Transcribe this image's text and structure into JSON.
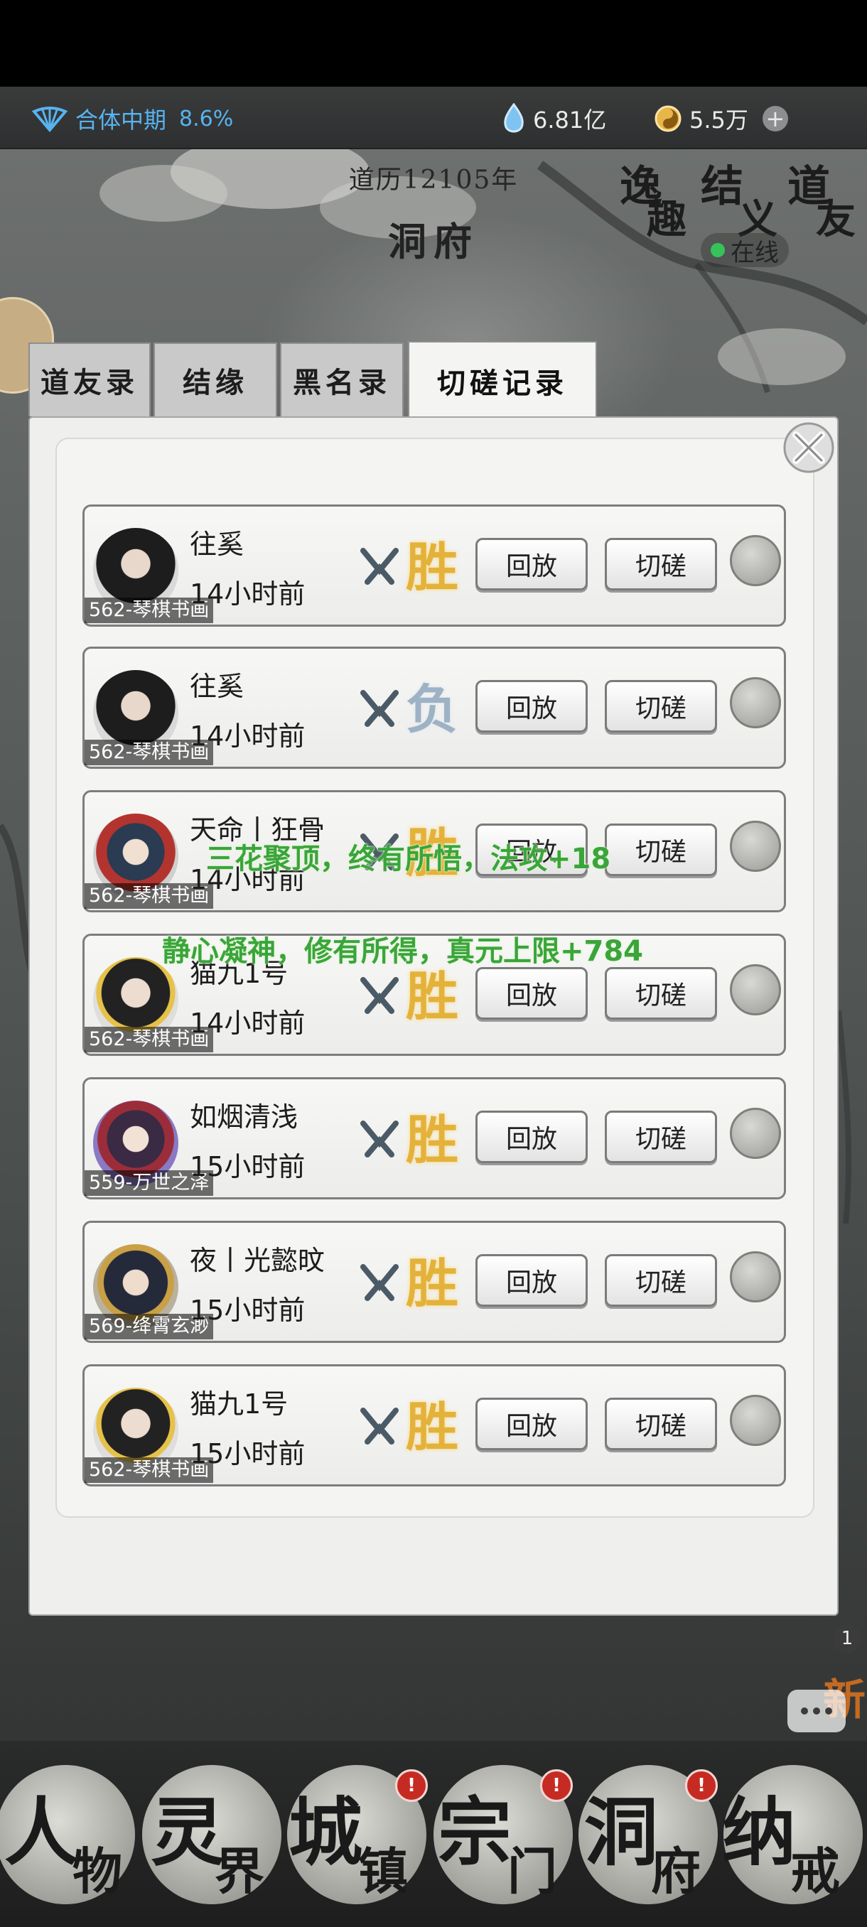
{
  "header": {
    "realm": {
      "icon": "fan-icon",
      "label": "合体中期",
      "percent": "8.6%"
    },
    "resources": [
      {
        "icon": "spirit-stone-icon",
        "value": "6.81亿"
      },
      {
        "icon": "coin-icon",
        "value": "5.5万"
      }
    ],
    "add_label": "+"
  },
  "calendar": "道历12105年",
  "page_title": "洞府",
  "seal": {
    "chars": [
      "逸",
      "趣",
      "结",
      "义",
      "道",
      "友"
    ]
  },
  "online_label": "在线",
  "tabs": [
    {
      "label": "道友录",
      "active": false
    },
    {
      "label": "结缘",
      "active": false
    },
    {
      "label": "黑名录",
      "active": false
    },
    {
      "label": "切磋记录",
      "active": true
    }
  ],
  "records": [
    {
      "name": "往奚",
      "time": "14小时前",
      "server": "562-琴棋书画",
      "result": "胜",
      "outcome": "win"
    },
    {
      "name": "往奚",
      "time": "14小时前",
      "server": "562-琴棋书画",
      "result": "负",
      "outcome": "lose"
    },
    {
      "name": "天命丨狂骨",
      "time": "14小时前",
      "server": "562-琴棋书画",
      "result": "胜",
      "outcome": "win"
    },
    {
      "name": "猫九1号",
      "time": "14小时前",
      "server": "562-琴棋书画",
      "result": "胜",
      "outcome": "win"
    },
    {
      "name": "如烟清浅",
      "time": "15小时前",
      "server": "559-万世之泽",
      "result": "胜",
      "outcome": "win"
    },
    {
      "name": "夜丨光懿旼",
      "time": "15小时前",
      "server": "569-绛霄玄渺",
      "result": "胜",
      "outcome": "win"
    },
    {
      "name": "猫九1号",
      "time": "15小时前",
      "server": "562-琴棋书画",
      "result": "胜",
      "outcome": "win"
    }
  ],
  "buttons": {
    "replay": "回放",
    "spar": "切磋"
  },
  "toasts": [
    "三花聚顶，终有所悟，法攻+18",
    "静心凝神，修有所得，真元上限+784"
  ],
  "side_badge": "1",
  "new_tag": "新",
  "nav": [
    {
      "big": "人",
      "small": "物",
      "badge": ""
    },
    {
      "big": "灵",
      "small": "界",
      "badge": ""
    },
    {
      "big": "城",
      "small": "镇",
      "badge": "!"
    },
    {
      "big": "宗",
      "small": "门",
      "badge": "!"
    },
    {
      "big": "洞",
      "small": "府",
      "badge": "!"
    },
    {
      "big": "纳",
      "small": "戒",
      "badge": ""
    }
  ],
  "colors": {
    "realm_blue": "#57b3f0",
    "win_gold": "#e3b23a",
    "toast_green": "#3aa53a",
    "online_green": "#36c45a"
  }
}
